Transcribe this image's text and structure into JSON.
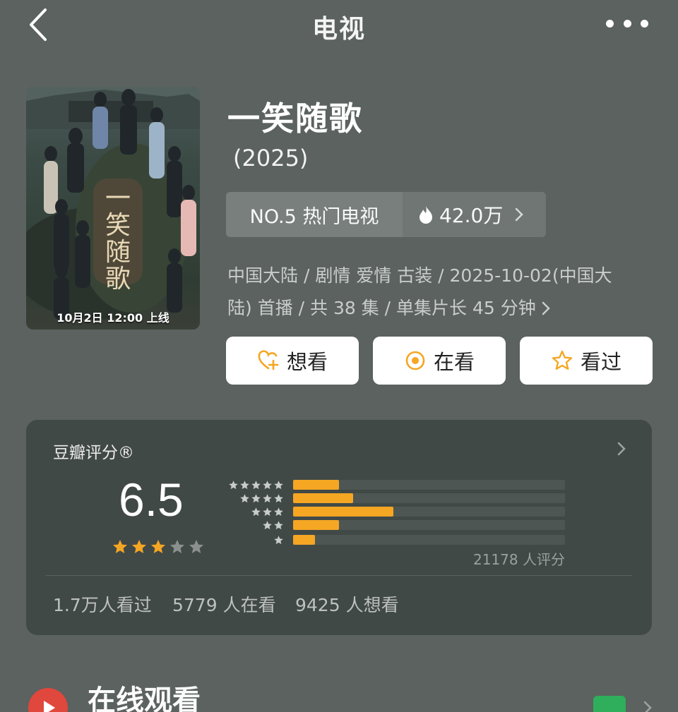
{
  "nav": {
    "title": "电视",
    "back_icon": "chevron-left-icon",
    "more_icon": "more-dots-icon"
  },
  "poster": {
    "caption": "10月2日 12:00 上线"
  },
  "show": {
    "title": "一笑随歌",
    "year": "(2025)",
    "rank_label": "NO.5 热门电视",
    "heat_value": "42.0万",
    "meta_line1": "中国大陆 / 剧情 爱情 古装 / 2025-10-02(中国大",
    "meta_line2": "陆) 首播 / 共 38 集 / 单集片长 45 分钟"
  },
  "actions": {
    "want_label": "想看",
    "watching_label": "在看",
    "watched_label": "看过"
  },
  "rating": {
    "label": "豆瓣评分®",
    "score": "6.5",
    "stars_filled": 3,
    "stars_total": 5,
    "distribution": [
      {
        "stars": 5,
        "fraction": 0.17
      },
      {
        "stars": 4,
        "fraction": 0.22
      },
      {
        "stars": 3,
        "fraction": 0.37
      },
      {
        "stars": 2,
        "fraction": 0.17
      },
      {
        "stars": 1,
        "fraction": 0.08
      }
    ],
    "count_text": "21178 人评分",
    "stats": {
      "watched": "1.7万人看过",
      "watching": "5779 人在看",
      "want": "9425 人想看"
    }
  },
  "online": {
    "title": "在线观看"
  },
  "colors": {
    "background": "#5b625f",
    "card": "#414947",
    "accent_orange": "#f5a623",
    "star_empty": "#8a908e"
  }
}
